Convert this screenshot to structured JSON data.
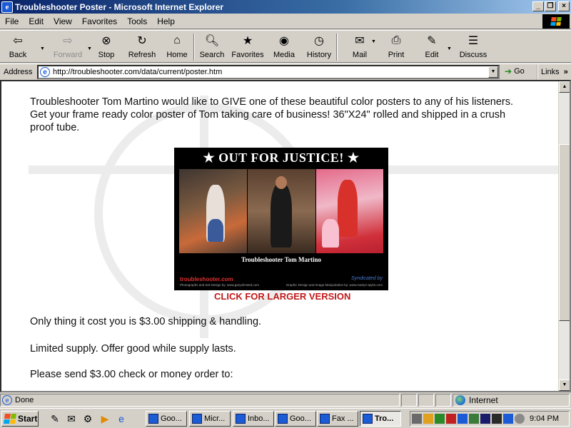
{
  "window": {
    "title": "Troubleshooter Poster - Microsoft Internet Explorer",
    "buttons": {
      "minimize": "_",
      "maximize": "❐",
      "close": "×"
    }
  },
  "menu": [
    {
      "key": "file",
      "label": "File"
    },
    {
      "key": "edit",
      "label": "Edit"
    },
    {
      "key": "view",
      "label": "View"
    },
    {
      "key": "favorites",
      "label": "Favorites"
    },
    {
      "key": "tools",
      "label": "Tools"
    },
    {
      "key": "help",
      "label": "Help"
    }
  ],
  "toolbar": {
    "back": "Back",
    "forward": "Forward",
    "stop": "Stop",
    "refresh": "Refresh",
    "home": "Home",
    "search": "Search",
    "favorites": "Favorites",
    "media": "Media",
    "history": "History",
    "mail": "Mail",
    "print": "Print",
    "edit": "Edit",
    "discuss": "Discuss"
  },
  "address": {
    "label": "Address",
    "url": "http://troubleshooter.com/data/current/poster.htm",
    "go": "Go",
    "links": "Links"
  },
  "page": {
    "intro": "Troubleshooter Tom Martino would like to GIVE one of these beautiful color posters to any of his listeners.  Get your frame ready color poster of Tom taking care of business! 36\"X24\" rolled and shipped in a crush proof tube.",
    "poster": {
      "title": "★ OUT FOR JUSTICE! ★",
      "caption": "Troubleshooter Tom Martino",
      "brand": "troubleshooter.com",
      "syndicated": "Syndicated by",
      "fine_left": "Photographs and Set Design by: www.garyolmsted.com",
      "fine_right": "Graphic Design and Image Manipulation by: www.martyn-taylor.com"
    },
    "click_link": "CLICK FOR LARGER VERSION",
    "cost": "Only thing it cost you is $3.00 shipping & handling.",
    "supply": "Limited supply.  Offer good while supply lasts.",
    "send": "Please send $3.00 check or money order to:"
  },
  "status": {
    "text": "Done",
    "zone": "Internet"
  },
  "taskbar": {
    "start": "Start",
    "tasks": [
      {
        "label": "Goo...",
        "active": false
      },
      {
        "label": "Micr...",
        "active": false
      },
      {
        "label": "Inbo...",
        "active": false
      },
      {
        "label": "Goo...",
        "active": false
      },
      {
        "label": "Fax ...",
        "active": false
      },
      {
        "label": "Tro...",
        "active": true
      }
    ],
    "time": "9:04 PM"
  },
  "colors": {
    "titlebar": "#0a246a",
    "chrome": "#d4d0c8",
    "link": "#c01818"
  }
}
